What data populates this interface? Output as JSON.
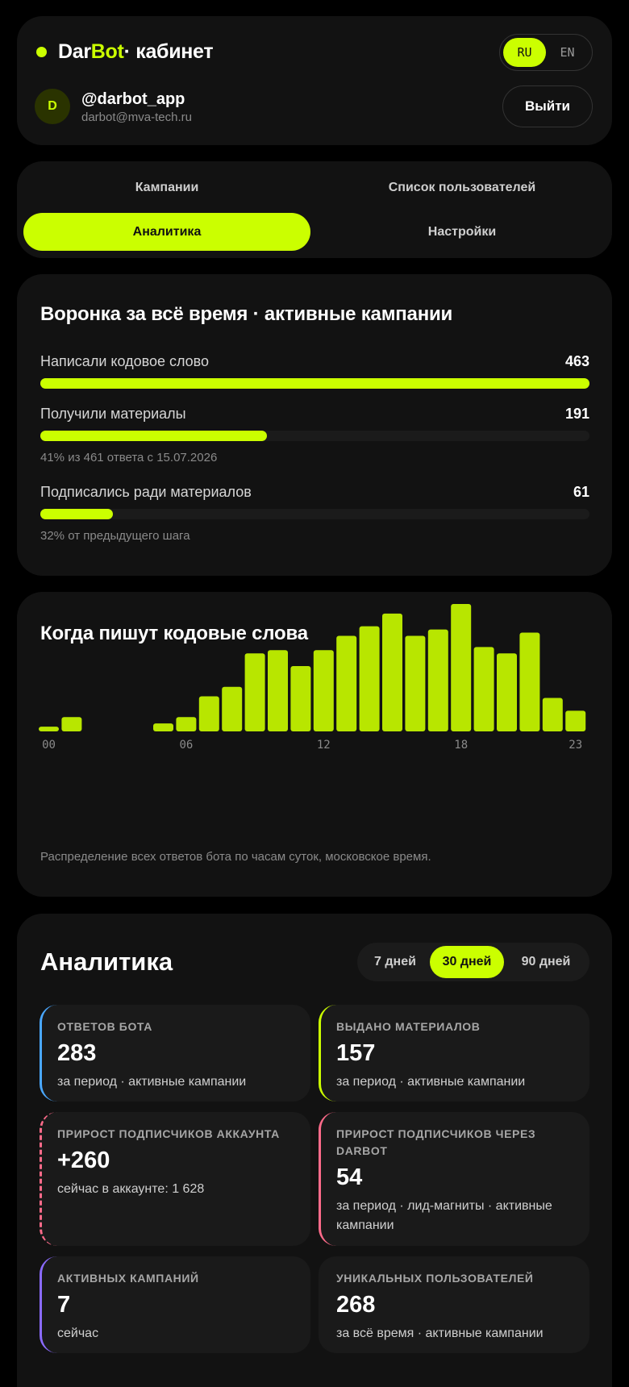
{
  "header": {
    "brand_part1": "Dar",
    "brand_part2": "Bot",
    "brand_part3": " · кабинет",
    "lang_ru": "RU",
    "lang_en": "EN",
    "lang_active": "RU",
    "avatar_letter": "D",
    "username": "@darbot_app",
    "email": "darbot@mva-tech.ru",
    "logout_label": "Выйти"
  },
  "tabs": {
    "campaigns": "Кампании",
    "users": "Список пользователей",
    "analytics": "Аналитика",
    "settings": "Настройки",
    "active": "analytics"
  },
  "funnel": {
    "title": "Воронка за всё время · активные кампании",
    "steps": [
      {
        "label": "Написали кодовое слово",
        "value": "463",
        "fraction": 1.0,
        "note": ""
      },
      {
        "label": "Получили материалы",
        "value": "191",
        "fraction": 0.413,
        "note": "41% из 461 ответа с 15.07.2026"
      },
      {
        "label": "Подписались ради материалов",
        "value": "61",
        "fraction": 0.132,
        "note": "32% от предыдущего шага"
      }
    ]
  },
  "hours": {
    "title": "Когда пишут кодовые слова",
    "caption": "Распределение всех ответов бота по часам суток, московское время.",
    "chart_data": {
      "type": "bar",
      "categories": [
        "00",
        "01",
        "02",
        "03",
        "04",
        "05",
        "06",
        "07",
        "08",
        "09",
        "10",
        "11",
        "12",
        "13",
        "14",
        "15",
        "16",
        "17",
        "18",
        "19",
        "20",
        "21",
        "22",
        "23"
      ],
      "values": [
        3,
        9,
        0,
        0,
        0,
        5,
        9,
        22,
        28,
        49,
        51,
        41,
        51,
        60,
        66,
        74,
        60,
        64,
        80,
        53,
        49,
        62,
        21,
        13
      ],
      "tick_labels": [
        "00",
        "06",
        "12",
        "18",
        "23"
      ],
      "title": "Когда пишут кодовые слова",
      "xlabel": "",
      "ylabel": "",
      "grid": false
    },
    "bar_color": "#b8e600"
  },
  "analytics": {
    "title": "Аналитика",
    "periods": [
      "7 дней",
      "30 дней",
      "90 дней"
    ],
    "active_period": "30 дней",
    "stats": [
      {
        "label": "ОТВЕТОВ БОТА",
        "value": "283",
        "sub": "за период · активные кампании",
        "color": "#4aa8ff"
      },
      {
        "label": "ВЫДАНО МАТЕРИАЛОВ",
        "value": "157",
        "sub": "за период · активные кампании",
        "color": "#cbff00"
      },
      {
        "label": "ПРИРОСТ ПОДПИСЧИКОВ АККАУНТА",
        "value": "+260",
        "sub": "сейчас в аккаунте: 1 628",
        "color": "#ff6b8a"
      },
      {
        "label": "ПРИРОСТ ПОДПИСЧИКОВ ЧЕРЕЗ DARBOT",
        "value": "54",
        "sub": "за период · лид-магниты · активные кампании",
        "color": "#ff6b8a"
      },
      {
        "label": "АКТИВНЫХ КАМПАНИЙ",
        "value": "7",
        "sub": "сейчас",
        "color": "#8b6bff"
      },
      {
        "label": "УНИКАЛЬНЫХ ПОЛЬЗОВАТЕЛЕЙ",
        "value": "268",
        "sub": "за всё время · активные кампании",
        "color": "#1a1a1a"
      }
    ]
  }
}
